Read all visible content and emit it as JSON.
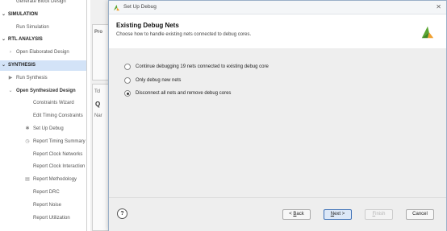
{
  "flow_navigator": {
    "items": [
      {
        "kind": "item",
        "label": "Generate Block Design",
        "icon": ""
      },
      {
        "kind": "section",
        "label": "SIMULATION",
        "expanded": true
      },
      {
        "kind": "item",
        "label": "Run Simulation",
        "icon": ""
      },
      {
        "kind": "section",
        "label": "RTL ANALYSIS",
        "expanded": true
      },
      {
        "kind": "item",
        "label": "Open Elaborated Design",
        "icon": "chevron-right"
      },
      {
        "kind": "section",
        "label": "SYNTHESIS",
        "expanded": true,
        "selected": true
      },
      {
        "kind": "item",
        "label": "Run Synthesis",
        "icon": "play"
      },
      {
        "kind": "item",
        "label": "Open Synthesized Design",
        "icon": "chevron-down",
        "bold": true
      },
      {
        "kind": "subitem",
        "label": "Constraints Wizard",
        "icon": ""
      },
      {
        "kind": "subitem",
        "label": "Edit Timing Constraints",
        "icon": ""
      },
      {
        "kind": "subitem",
        "label": "Set Up Debug",
        "icon": "bug"
      },
      {
        "kind": "subitem",
        "label": "Report Timing Summary",
        "icon": "clock"
      },
      {
        "kind": "subitem",
        "label": "Report Clock Networks",
        "icon": ""
      },
      {
        "kind": "subitem",
        "label": "Report Clock Interaction",
        "icon": ""
      },
      {
        "kind": "subitem",
        "label": "Report Methodology",
        "icon": "doc"
      },
      {
        "kind": "subitem",
        "label": "Report DRC",
        "icon": ""
      },
      {
        "kind": "subitem",
        "label": "Report Noise",
        "icon": ""
      },
      {
        "kind": "subitem",
        "label": "Report Utilization",
        "icon": ""
      }
    ]
  },
  "background": {
    "properties_label": "Pro",
    "tcl_label": "Tcl",
    "search_glyph": "Q",
    "name_label": "Nar"
  },
  "dialog": {
    "title": "Set Up Debug",
    "page_title": "Existing Debug Nets",
    "page_subtitle": "Choose how to handle existing nets connected to debug cores.",
    "options": [
      {
        "label": "Continue debugging 19 nets connected to existing debug core",
        "selected": false
      },
      {
        "label": "Only debug new nets",
        "selected": false
      },
      {
        "label": "Disconnect all nets and remove debug cores",
        "selected": true
      }
    ],
    "buttons": {
      "help": "?",
      "back_prefix": "< ",
      "back_mnemonic": "B",
      "back_rest": "ack",
      "next_mnemonic": "N",
      "next_rest": "ext >",
      "finish_mnemonic": "F",
      "finish_rest": "inish",
      "cancel": "Cancel"
    }
  },
  "colors": {
    "selection": "#d3e3f7",
    "accent": "#3b6fb6",
    "logo_green": "#5aa532",
    "logo_orange": "#f0a030"
  }
}
